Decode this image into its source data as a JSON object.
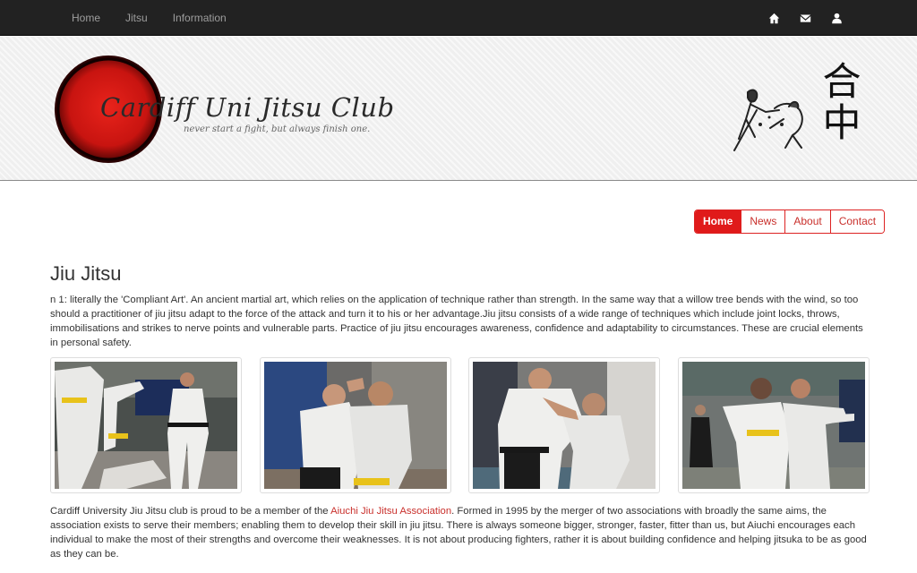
{
  "navbar": {
    "links": [
      "Home",
      "Jitsu",
      "Information"
    ],
    "icons": [
      "home-icon",
      "envelope-icon",
      "user-icon"
    ]
  },
  "banner": {
    "club_name": "Cardiff Uni Jitsu Club",
    "tagline": "never start a fight, but always finish one.",
    "kanji": "合中"
  },
  "pills": [
    "Home",
    "News",
    "About",
    "Contact"
  ],
  "content": {
    "title": "Jiu Jitsu",
    "intro": "n 1: literally the 'Compliant Art'. An ancient martial art, which relies on the application of technique rather than strength. In the same way that a willow tree bends with the wind, so too should a practitioner of jiu jitsu adapt to the force of the attack and turn it to his or her advantage.Jiu jitsu consists of a wide range of techniques which include joint locks, throws, immobilisations and strikes to nerve points and vulnerable parts. Practice of jiu jitsu encourages awareness, confidence and adaptability to circumstances. These are crucial elements in personal safety.",
    "para2_before": "Cardiff University Jiu Jitsu club is proud to be a member of the ",
    "para2_link": "Aiuchi Jiu Jitsu Association",
    "para2_after": ". Formed in 1995 by the merger of two associations with broadly the same aims, the association exists to serve their members; enabling them to develop their skill in jiu jitsu. There is always someone bigger, stronger, faster, fitter than us, but Aiuchi encourages each individual to make the most of their strengths and overcome their weaknesses. It is not about producing fighters, rather it is about building confidence and helping jitsuka to be as good as they can be."
  },
  "colors": {
    "navbar_bg": "#222222",
    "accent_red": "#e01a1a",
    "link_red": "#c9302c"
  }
}
